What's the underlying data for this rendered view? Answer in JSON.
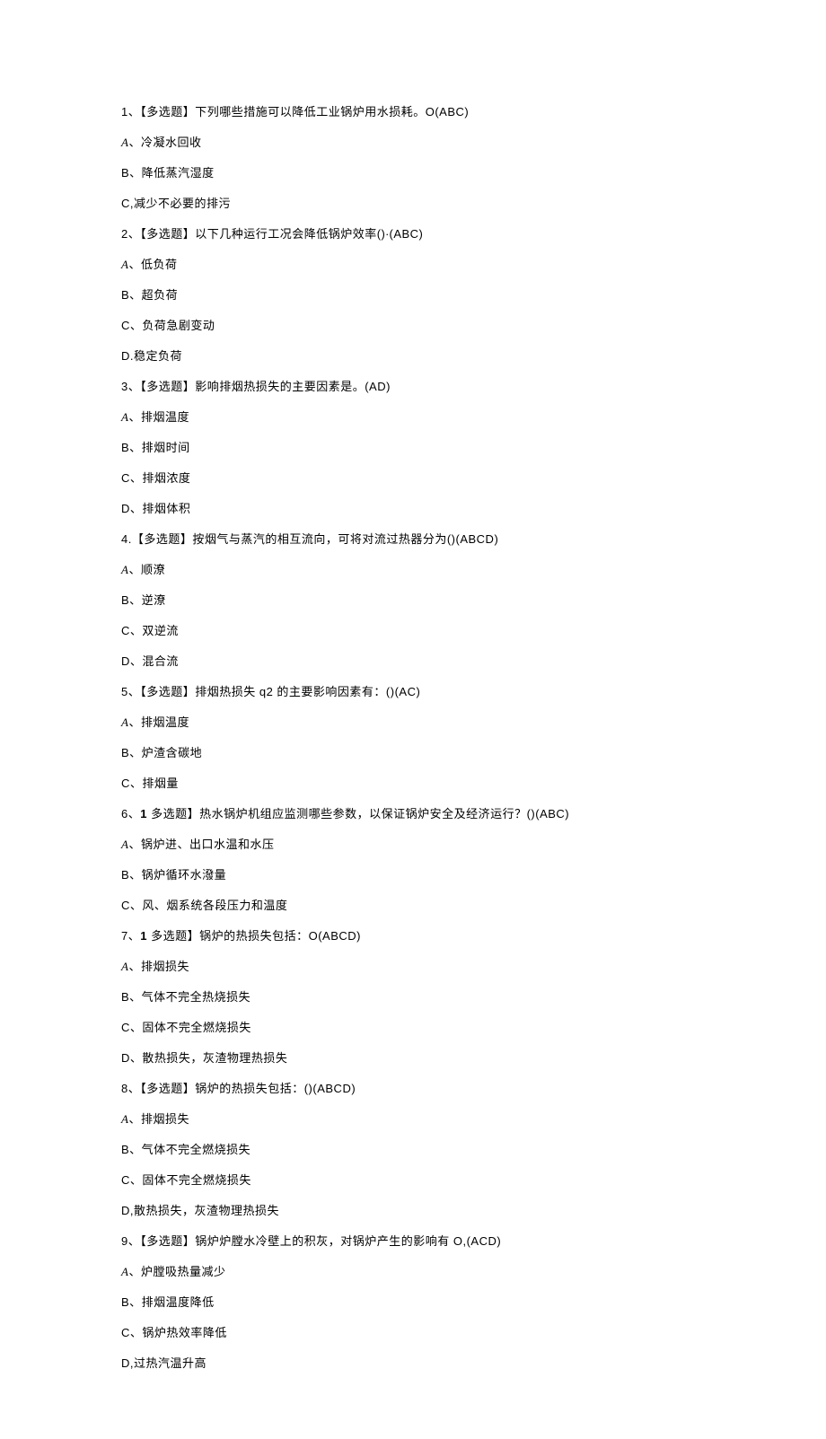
{
  "lines": [
    "1、【多选题】下列哪些措施可以降低工业锅炉用水损耗。O(ABC)",
    "A、冷凝水回收",
    "B、降低蒸汽湿度",
    "C,减少不必要的排污",
    "2、【多选题】以下几种运行工况会降低锅炉效率()∙(ABC)",
    "A、低负荷",
    "B、超负荷",
    "C、负荷急剧变动",
    "D.稳定负荷",
    "3、【多选题】影响排烟热损失的主要因素是。(AD)",
    "A、排烟温度",
    "B、排烟时间",
    "C、排烟浓度",
    "D、排烟体积",
    "4.【多选题】按烟气与蒸汽的相互流向，可将对流过热器分为()(ABCD)",
    "A、顺潦",
    "B、逆潦",
    "C、双逆流",
    "D、混合流",
    "5、【多选题】排烟热损失 q2 的主要影响因素有：()(AC)",
    "A、排烟温度",
    "B、炉渣含碳地",
    "C、排烟量",
    "6、1 多选题】热水锅炉机组应监测哪些参数，以保证锅炉安全及经济运行？()(ABC)",
    "A、锅炉进、出口水温和水压",
    "B、锅炉循环水潑量",
    "C、风、烟系统各段压力和温度",
    "7、1 多选题】锅炉的热损失包括：O(ABCD)",
    "A、排烟损失",
    "B、气体不完全热烧损失",
    "C、固体不完全燃烧损失",
    "D、散热损失，灰渣物理热损失",
    "8、【多选题】锅炉的热损失包括：()(ABCD)",
    "A、排烟损失",
    "B、气体不完全燃烧损失",
    "C、固体不完全燃烧损失",
    "D,散热损失，灰渣物理热损失",
    "9、【多选题】锅炉炉膛水冷壁上的积灰，对锅炉产生的影响有 O,(ACD)",
    "A、炉膛吸热量减少",
    "B、排烟温度降低",
    "C、锅炉热效率降低",
    "D,过热汽温升高"
  ]
}
